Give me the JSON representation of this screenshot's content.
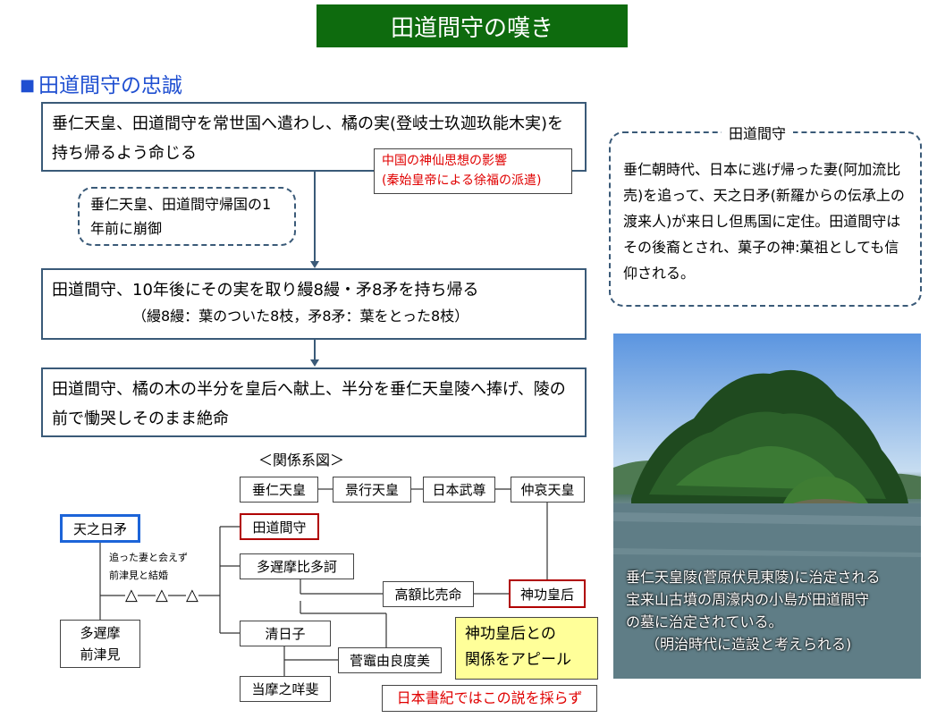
{
  "title": "田道間守の嘆き",
  "section_heading": "田道間守の忠誠",
  "flow": {
    "step1": "垂仁天皇、田道間守を常世国へ遣わし、橘の実(登岐士玖迦玖能木実)を持ち帰るよう命じる",
    "step1_note_line1": "中国の神仙思想の影響",
    "step1_note_line2": "(秦始皇帝による徐福の派遣)",
    "side_note": "垂仁天皇、田道間守帰国の1年前に崩御",
    "step2_line1": "田道間守、10年後にその実を取り縵8縵・矛8矛を持ち帰る",
    "step2_line2": "（縵8縵：葉のついた8枝，矛8矛：葉をとった8枝）",
    "step3": "田道間守、橘の木の半分を皇后へ献上、半分を垂仁天皇陵へ捧げ、陵の前で慟哭しそのまま絶命"
  },
  "info_box": {
    "heading": "田道間守",
    "body": "垂仁朝時代、日本に逃げ帰った妻(阿加流比売)を追って、天之日矛(新羅からの伝承上の渡来人)が来日し但馬国に定住。田道間守はその後裔とされ、菓子の神:菓祖としても信仰される。"
  },
  "photo_caption": {
    "line1": "垂仁天皇陵(菅原伏見東陵)に治定される",
    "line2": "宝来山古墳の周濠内の小島が田道間守",
    "line3": "の墓に治定されている。",
    "line4": "（明治時代に造設と考えられる)"
  },
  "genealogy": {
    "title": "＜関係系図＞",
    "nodes": {
      "suinin": "垂仁天皇",
      "keiko": "景行天皇",
      "yamatotakeru": "日本武尊",
      "chuai": "仲哀天皇",
      "amenohiboko": "天之日矛",
      "tajimamori": "田道間守",
      "tajimahitaka": "多遅摩比多訶",
      "takanuka": "高額比売命",
      "jingu": "神功皇后",
      "kiyohiko": "清日子",
      "sugakamayura": "菅竈由良度美",
      "tagimanomehi": "当摩之咩斐",
      "tajima_line1": "多遅摩",
      "tajima_line2": "前津見"
    },
    "note_line1": "追った妻と会えず",
    "note_line2": "前津見と結婚",
    "triangle": "△",
    "yellow_line1": "神功皇后との",
    "yellow_line2": "関係をアピール",
    "red_note": "日本書紀ではこの説を採らず"
  }
}
